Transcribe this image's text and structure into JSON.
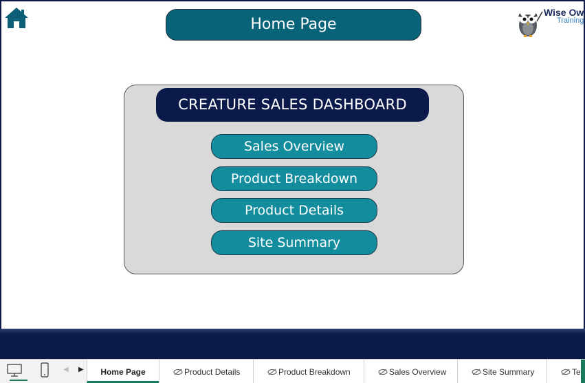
{
  "header": {
    "page_title": "Home Page",
    "logo": {
      "line1": "Wise Owl",
      "line2": "Training"
    }
  },
  "dashboard": {
    "title": "CREATURE SALES DASHBOARD",
    "buttons": [
      {
        "label": "Sales Overview"
      },
      {
        "label": "Product Breakdown"
      },
      {
        "label": "Product Details"
      },
      {
        "label": "Site Summary"
      }
    ]
  },
  "tabs": [
    {
      "label": "Home Page",
      "active": true,
      "hidden_icon": false
    },
    {
      "label": "Product Details",
      "active": false,
      "hidden_icon": true
    },
    {
      "label": "Product Breakdown",
      "active": false,
      "hidden_icon": true
    },
    {
      "label": "Sales Overview",
      "active": false,
      "hidden_icon": true
    },
    {
      "label": "Site Summary",
      "active": false,
      "hidden_icon": true
    },
    {
      "label": "Ter",
      "active": false,
      "hidden_icon": true
    }
  ],
  "colors": {
    "title_pill": "#086379",
    "dash_title": "#0b1a4a",
    "nav_button": "#138d9d",
    "panel": "#d9d9d9",
    "accent": "#1a7a5e"
  },
  "icons": {
    "home": "home-icon",
    "desktop": "desktop-icon",
    "mobile": "mobile-icon",
    "prev": "chevron-left-icon",
    "next": "chevron-right-icon",
    "hidden": "hidden-eye-icon"
  }
}
